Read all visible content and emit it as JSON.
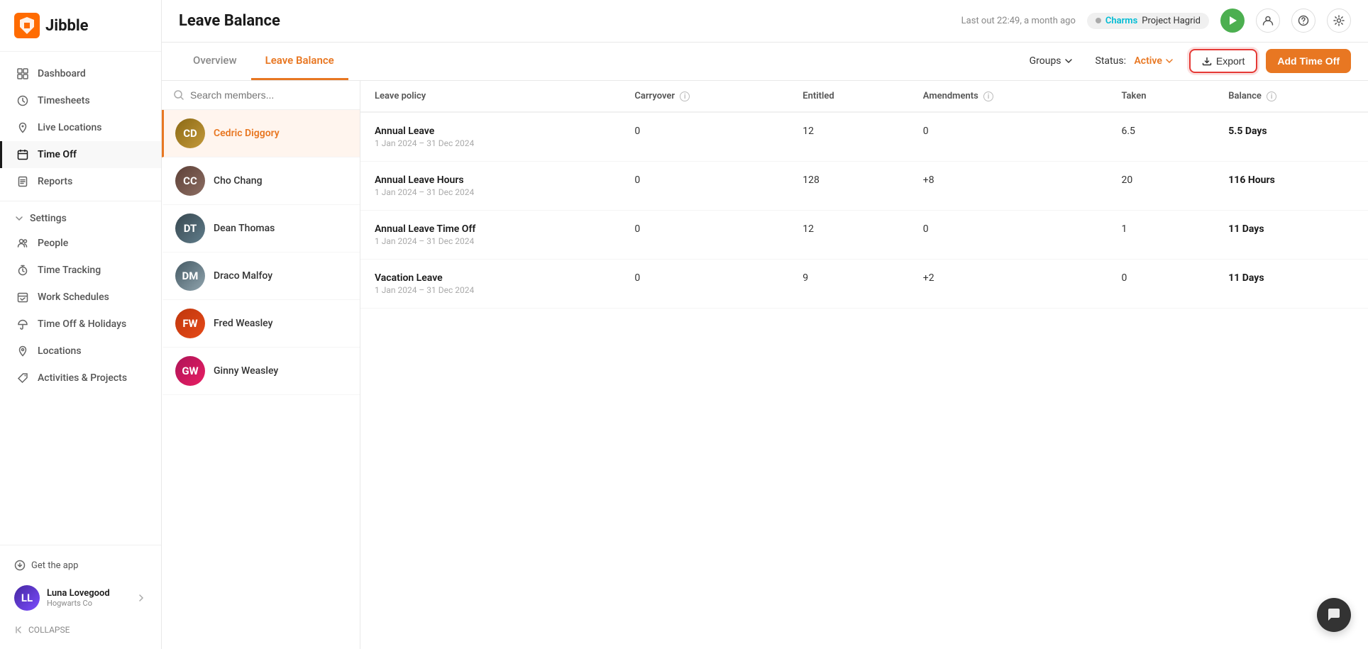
{
  "app": {
    "name": "Jibble"
  },
  "header": {
    "page_title": "Leave Balance",
    "last_out": "Last out 22:49, a month ago",
    "timer": {
      "name": "Charms",
      "project": "Project Hagrid"
    }
  },
  "tabs": {
    "overview_label": "Overview",
    "leave_balance_label": "Leave Balance"
  },
  "toolbar": {
    "groups_label": "Groups",
    "status_label": "Status:",
    "status_value": "Active",
    "export_label": "Export",
    "add_time_off_label": "Add Time Off"
  },
  "search": {
    "placeholder": "Search members..."
  },
  "members": [
    {
      "id": "cedric",
      "name": "Cedric Diggory",
      "initials": "CD",
      "active": true
    },
    {
      "id": "cho",
      "name": "Cho Chang",
      "initials": "CC",
      "active": false
    },
    {
      "id": "dean",
      "name": "Dean Thomas",
      "initials": "DT",
      "active": false
    },
    {
      "id": "draco",
      "name": "Draco Malfoy",
      "initials": "DM",
      "active": false
    },
    {
      "id": "fred",
      "name": "Fred Weasley",
      "initials": "FW",
      "active": false
    },
    {
      "id": "ginny",
      "name": "Ginny Weasley",
      "initials": "GW",
      "active": false
    }
  ],
  "table": {
    "columns": {
      "leave_policy": "Leave policy",
      "carryover": "Carryover",
      "entitled": "Entitled",
      "amendments": "Amendments",
      "taken": "Taken",
      "balance": "Balance"
    },
    "rows": [
      {
        "policy_name": "Annual Leave",
        "policy_date": "1 Jan 2024 – 31 Dec 2024",
        "carryover": "0",
        "entitled": "12",
        "amendments": "0",
        "taken": "6.5",
        "balance": "5.5 Days"
      },
      {
        "policy_name": "Annual Leave Hours",
        "policy_date": "1 Jan 2024 – 31 Dec 2024",
        "carryover": "0",
        "entitled": "128",
        "amendments": "+8",
        "taken": "20",
        "balance": "116 Hours"
      },
      {
        "policy_name": "Annual Leave Time Off",
        "policy_date": "1 Jan 2024 – 31 Dec 2024",
        "carryover": "0",
        "entitled": "12",
        "amendments": "0",
        "taken": "1",
        "balance": "11 Days"
      },
      {
        "policy_name": "Vacation Leave",
        "policy_date": "1 Jan 2024 – 31 Dec 2024",
        "carryover": "0",
        "entitled": "9",
        "amendments": "+2",
        "taken": "0",
        "balance": "11 Days"
      }
    ]
  },
  "sidebar": {
    "nav_items": [
      {
        "id": "dashboard",
        "label": "Dashboard",
        "icon": "grid"
      },
      {
        "id": "timesheets",
        "label": "Timesheets",
        "icon": "clock"
      },
      {
        "id": "live-locations",
        "label": "Live Locations",
        "icon": "map-pin"
      },
      {
        "id": "time-off",
        "label": "Time Off",
        "icon": "calendar"
      },
      {
        "id": "reports",
        "label": "Reports",
        "icon": "file-text"
      }
    ],
    "settings_items": [
      {
        "id": "settings",
        "label": "Settings",
        "icon": "settings"
      },
      {
        "id": "people",
        "label": "People",
        "icon": "users"
      },
      {
        "id": "time-tracking",
        "label": "Time Tracking",
        "icon": "timer"
      },
      {
        "id": "work-schedules",
        "label": "Work Schedules",
        "icon": "calendar-check"
      },
      {
        "id": "time-off-holidays",
        "label": "Time Off & Holidays",
        "icon": "umbrella"
      },
      {
        "id": "locations",
        "label": "Locations",
        "icon": "location"
      },
      {
        "id": "activities-projects",
        "label": "Activities & Projects",
        "icon": "tag"
      }
    ],
    "get_app_label": "Get the app",
    "user": {
      "name": "Luna Lovegood",
      "company": "Hogwarts Co"
    },
    "collapse_label": "COLLAPSE"
  }
}
